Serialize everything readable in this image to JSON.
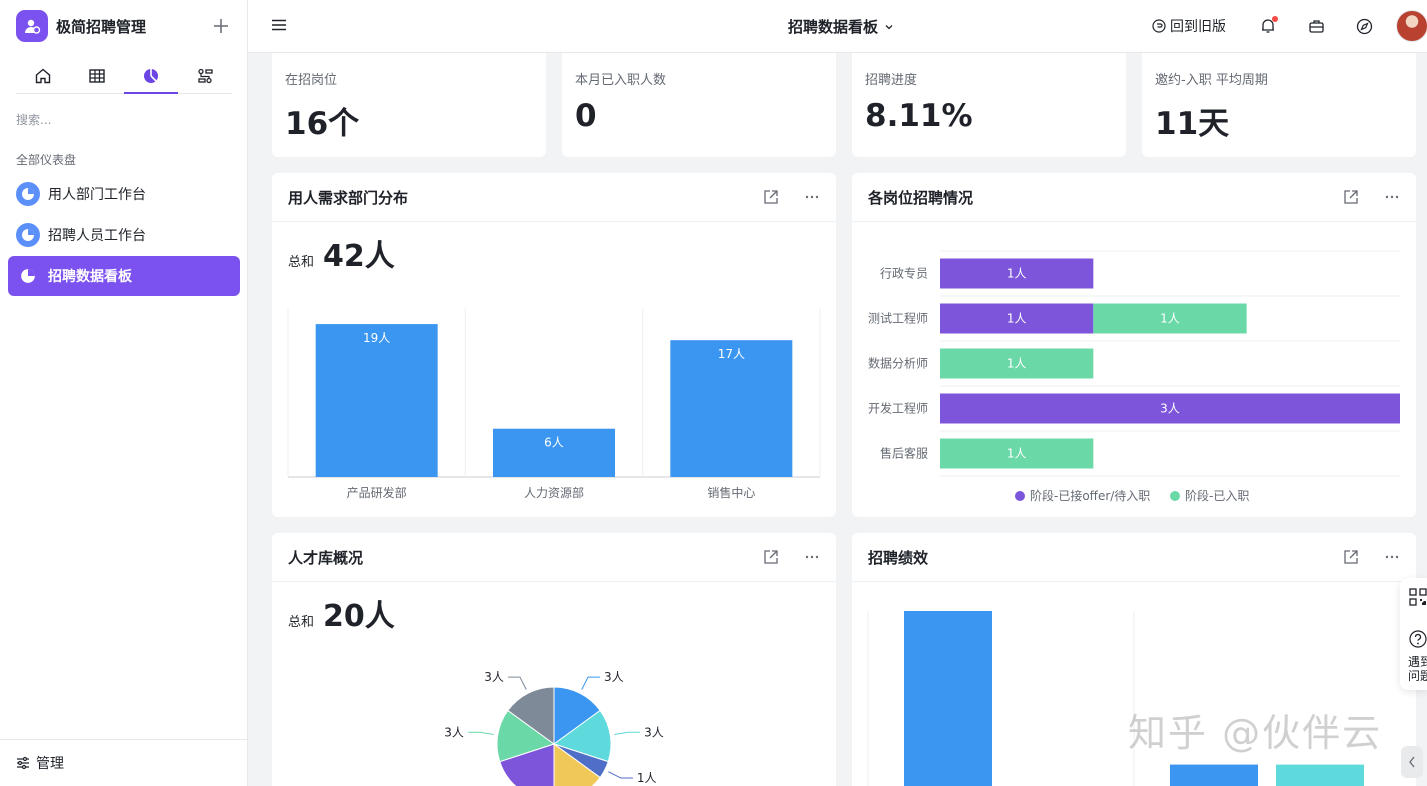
{
  "app": {
    "title": "极简招聘管理"
  },
  "sidebar": {
    "search_placeholder": "搜索...",
    "group_label": "全部仪表盘",
    "items": [
      {
        "label": "用人部门工作台",
        "active": false
      },
      {
        "label": "招聘人员工作台",
        "active": false
      },
      {
        "label": "招聘数据看板",
        "active": true
      }
    ],
    "bottom_label": "管理",
    "tabs": [
      "home-icon",
      "table-icon",
      "dashboard-icon",
      "flow-icon"
    ]
  },
  "header": {
    "title": "招聘数据看板",
    "revert_label": "回到旧版"
  },
  "stats": [
    {
      "label": "在招岗位",
      "value": "16个"
    },
    {
      "label": "本月已入职人数",
      "value": "0"
    },
    {
      "label": "招聘进度",
      "value": "8.11%"
    },
    {
      "label": "邀约-入职 平均周期",
      "value": "11天"
    }
  ],
  "cards": {
    "dept": {
      "title": "用人需求部门分布",
      "total_label": "总和",
      "total_value": "42人"
    },
    "positions": {
      "title": "各岗位招聘情况"
    },
    "talent": {
      "title": "人才库概况",
      "total_label": "总和",
      "total_value": "20人"
    },
    "performance": {
      "title": "招聘绩效"
    }
  },
  "chart_data": [
    {
      "type": "bar",
      "title": "用人需求部门分布",
      "categories": [
        "产品研发部",
        "人力资源部",
        "销售中心"
      ],
      "values": [
        19,
        6,
        17
      ],
      "data_labels": [
        "19人",
        "6人",
        "17人"
      ],
      "ylim": [
        0,
        21
      ],
      "color": "#3a96f0"
    },
    {
      "type": "bar",
      "orientation": "horizontal-stacked",
      "title": "各岗位招聘情况",
      "categories": [
        "行政专员",
        "测试工程师",
        "数据分析师",
        "开发工程师",
        "售后客服"
      ],
      "series": [
        {
          "name": "阶段-已接offer/待入职",
          "values": [
            1,
            1,
            0,
            3,
            0
          ],
          "color": "#7c55db"
        },
        {
          "name": "阶段-已入职",
          "values": [
            0,
            1,
            1,
            0,
            1
          ],
          "color": "#6bd8a8"
        }
      ],
      "xlim": [
        0,
        3
      ],
      "legend": "bottom"
    },
    {
      "type": "pie",
      "title": "人才库概况",
      "slices": [
        {
          "label": "3人",
          "value": 3,
          "color": "#3a96f0"
        },
        {
          "label": "3人",
          "value": 3,
          "color": "#5ed9dc"
        },
        {
          "label": "1人",
          "value": 1,
          "color": "#4f6ec7"
        },
        {
          "label": "3人",
          "value": 3,
          "color": "#f0c85a"
        },
        {
          "label": "",
          "value": 4,
          "color": "#7c55db"
        },
        {
          "label": "3人",
          "value": 3,
          "color": "#6bd8a8"
        },
        {
          "label": "3人",
          "value": 3,
          "color": "#7e8a98"
        }
      ]
    },
    {
      "type": "bar",
      "title": "招聘绩效",
      "series": [
        {
          "values": [
            1,
            0.2
          ],
          "color": "#3a96f0"
        },
        {
          "values": [
            0,
            0.2
          ],
          "color": "#5ed9dc"
        }
      ]
    }
  ],
  "overlay": {
    "watermark": "知乎 @伙伴云",
    "help_text_1": "遇到",
    "help_text_2": "问题"
  }
}
